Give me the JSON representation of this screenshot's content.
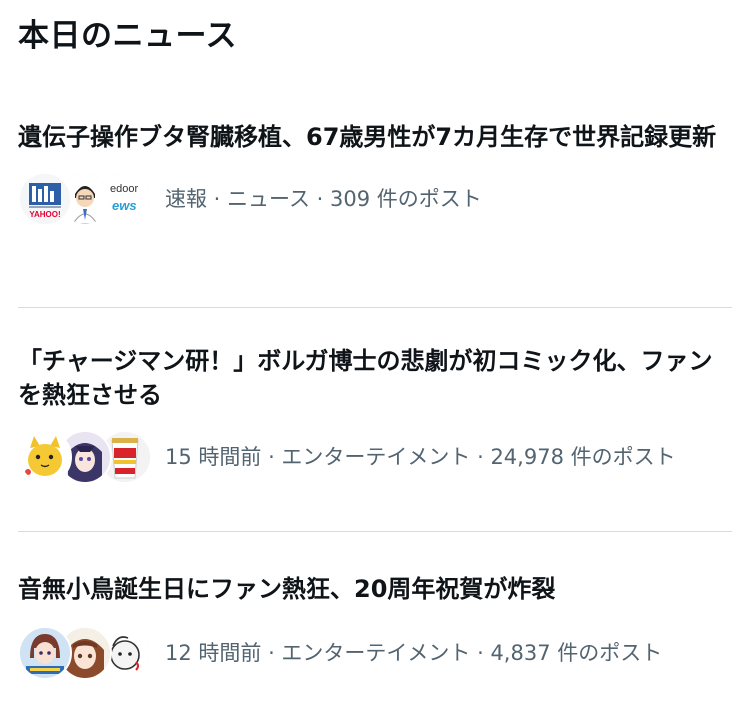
{
  "section": {
    "title": "本日のニュース"
  },
  "news": [
    {
      "headline": "遺伝子操作ブタ腎臓移植、67歳男性が7カ月生存で世界記録更新",
      "meta": "速報 · ニュース · 309 件のポスト",
      "avatars": [
        "yahoo-news-logo-icon",
        "cartoon-man-avatar-icon",
        "livedoor-news-logo-icon"
      ],
      "avatar_texts": [
        "YAHOO!",
        "edoor",
        "ews"
      ]
    },
    {
      "headline": "「チャージマン研！」ボルガ博士の悲劇が初コミック化、ファンを熱狂させる",
      "meta": "15 時間前 · エンターテイメント · 24,978 件のポスト",
      "avatars": [
        "yellow-cat-character-avatar-icon",
        "anime-character-avatar-icon",
        "cup-noodle-avatar-icon"
      ]
    },
    {
      "headline": "音無小鳥誕生日にファン熱狂、20周年祝賀が炸裂",
      "meta": "12 時間前 · エンターテイメント · 4,837 件のポスト",
      "avatars": [
        "idolmaster-avatar-icon",
        "anime-girl-avatar-icon",
        "mascot-drawing-avatar-icon"
      ]
    }
  ],
  "colors": {
    "text_primary": "#0f1419",
    "text_secondary": "#536471",
    "divider": "#d6dbdf",
    "background": "#ffffff"
  }
}
